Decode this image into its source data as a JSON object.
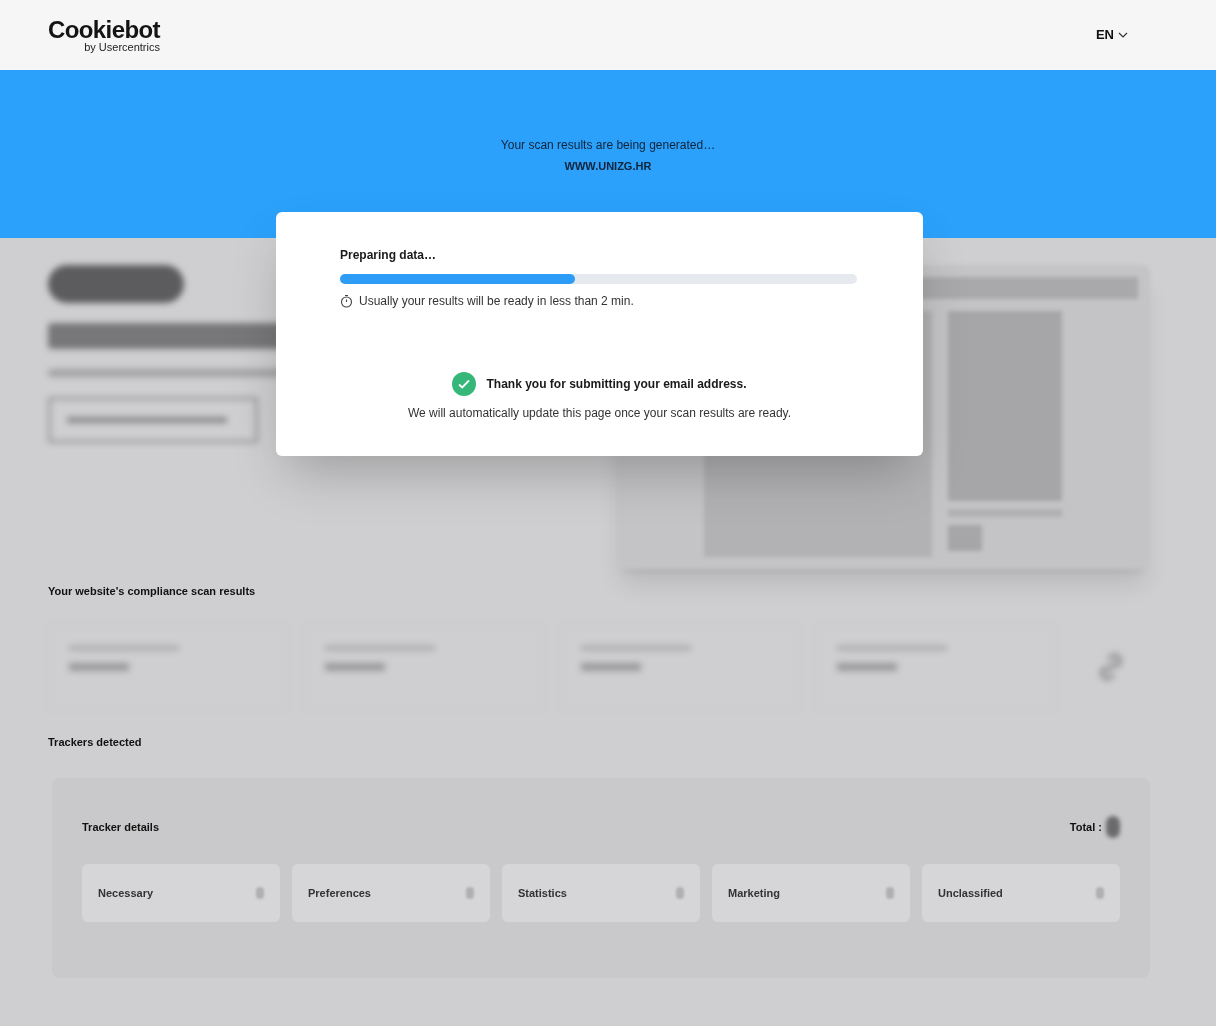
{
  "header": {
    "logo": "Cookiebot",
    "logo_sub": "by Usercentrics",
    "language": "EN"
  },
  "banner": {
    "message": "Your scan results are being generated…",
    "domain": "WWW.UNIZG.HR"
  },
  "modal": {
    "title": "Preparing data…",
    "progress": {
      "level": 0.455
    },
    "hint": "Usually your results will be ready in less than 2 min.",
    "confirmation": "Thank you for submitting your email address.",
    "note": "We will automatically update this page once your scan results are ready."
  },
  "results": {
    "heading": "Your website's compliance scan results"
  },
  "trackers": {
    "heading": "Trackers detected",
    "panel_title": "Tracker details",
    "total_label": "Total :",
    "categories": [
      {
        "label": "Necessary"
      },
      {
        "label": "Preferences"
      },
      {
        "label": "Statistics"
      },
      {
        "label": "Marketing"
      },
      {
        "label": "Unclassified"
      }
    ]
  }
}
